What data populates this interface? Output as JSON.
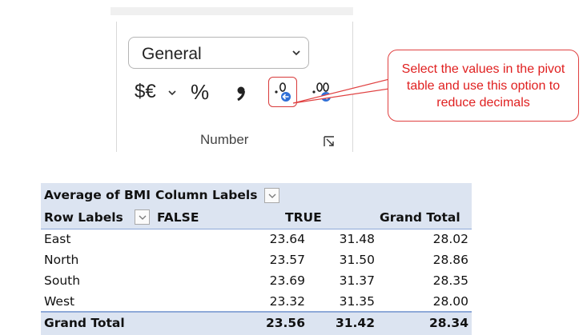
{
  "ribbon": {
    "number_format": "General",
    "currency_symbol": "$€",
    "percent_symbol": "%",
    "comma_symbol": "❟",
    "decimal_label_decrease": ".0",
    "decimal_label_increase": ".00",
    "group_label": "Number",
    "accent_color": "#2f6fd6",
    "highlight_color": "#d83a3a"
  },
  "callout": {
    "text": "Select the values in the pivot table and use this option to reduce decimals",
    "color": "#e02020"
  },
  "pivot": {
    "value_field": "Average of BMI",
    "column_labels": "Column Labels",
    "row_labels": "Row Labels",
    "columns": [
      "FALSE",
      "TRUE",
      "Grand Total"
    ],
    "rows": [
      {
        "label": "East",
        "values": [
          "23.64",
          "31.48",
          "28.02"
        ]
      },
      {
        "label": "North",
        "values": [
          "23.57",
          "31.50",
          "28.86"
        ]
      },
      {
        "label": "South",
        "values": [
          "23.69",
          "31.37",
          "28.35"
        ]
      },
      {
        "label": "West",
        "values": [
          "23.32",
          "31.35",
          "28.00"
        ]
      }
    ],
    "grand_total": {
      "label": "Grand Total",
      "values": [
        "23.56",
        "31.42",
        "28.34"
      ]
    },
    "header_fill": "#dce4f1"
  }
}
